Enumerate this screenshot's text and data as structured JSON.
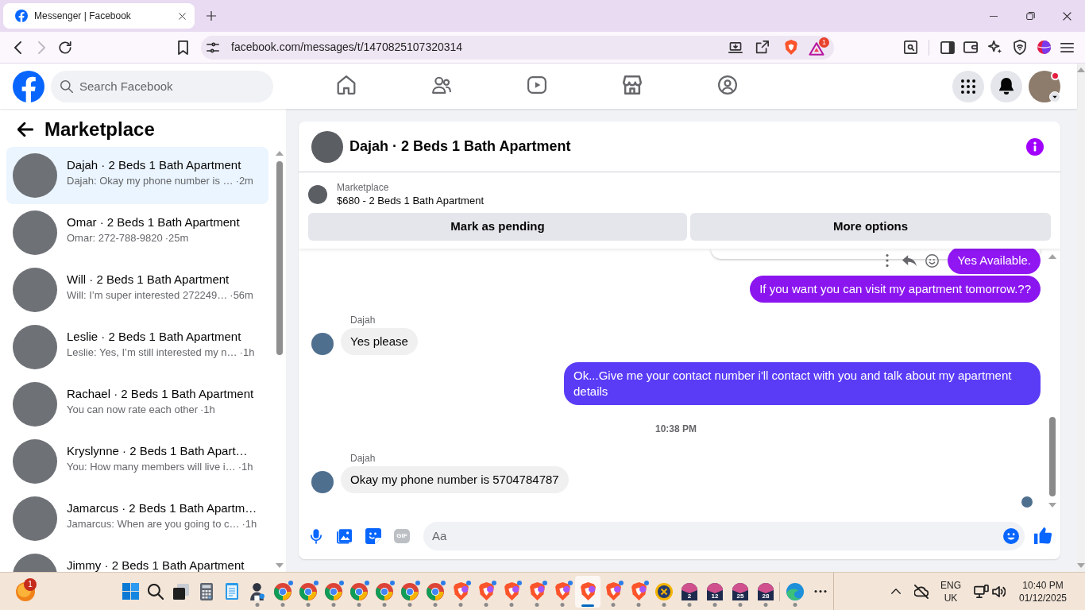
{
  "browser": {
    "tabs": [
      {
        "title": "Messenger | Facebook",
        "selected": true
      }
    ],
    "nav": [
      {
        "kind": "back",
        "disabled": false
      },
      {
        "kind": "forward",
        "disabled": true
      },
      {
        "kind": "reload",
        "disabled": false
      }
    ],
    "url": "facebook.com/messages/t/1470825107320314",
    "rewards_badge": "1"
  },
  "header": {
    "search": {
      "placeholder": "Search Facebook"
    },
    "nav": [
      {
        "kind": "home",
        "selected": false
      },
      {
        "kind": "friends",
        "selected": false
      },
      {
        "kind": "video",
        "selected": false
      },
      {
        "kind": "marketplace",
        "selected": false
      },
      {
        "kind": "groups",
        "selected": false
      }
    ],
    "profile_alert": true
  },
  "sidebar": {
    "title": "Marketplace",
    "conversations": [
      {
        "title": "Dajah · 2 Beds 1 Bath Apartment",
        "preview": "Dajah: Okay my phone number is …",
        "time": "·2m",
        "selected": true
      },
      {
        "title": "Omar · 2 Beds 1 Bath Apartment",
        "preview": "Omar: 272-788-9820",
        "time": "·25m",
        "selected": false
      },
      {
        "title": "Will · 2 Beds 1 Bath Apartment",
        "preview": "Will: I’m super interested 272249…",
        "time": "·56m",
        "selected": false
      },
      {
        "title": "Leslie · 2 Beds 1 Bath Apartment",
        "preview": "Leslie: Yes, I’m still interested my n…",
        "time": "·1h",
        "selected": false
      },
      {
        "title": "Rachael · 2 Beds 1 Bath Apartment",
        "preview": "You can now rate each other",
        "time": "·1h",
        "selected": false
      },
      {
        "title": "Kryslynne · 2 Beds 1 Bath Apart…",
        "preview": "You: How many members will live i…",
        "time": "·1h",
        "selected": false
      },
      {
        "title": "Jamarcus · 2 Beds 1 Bath Apartm…",
        "preview": "Jamarcus: When are you going to c…",
        "time": "·1h",
        "selected": false
      },
      {
        "title": "Jimmy · 2 Beds 1 Bath Apartment",
        "selected": false
      }
    ]
  },
  "chat": {
    "title": "Dajah · 2 Beds 1 Bath Apartment",
    "listing": {
      "source": "Marketplace",
      "title": "$680 - 2 Beds 1 Bath Apartment"
    },
    "actions": [
      {
        "label": "Mark as pending"
      },
      {
        "label": "More options"
      }
    ],
    "messages": [
      {
        "kind": "outgoing",
        "text": "Yes Available.",
        "color": "#9017f2",
        "hovered": true
      },
      {
        "kind": "outgoing",
        "text": "If you want you can visit my apartment tomorrow.??",
        "color": "#8b15ef",
        "hovered": false
      },
      {
        "kind": "incoming",
        "sender": "Dajah",
        "text": "Yes please"
      },
      {
        "kind": "outgoing",
        "text": "Ok...Give me your contact number i'll contact with you and talk about my apartment details",
        "color": "#5a3cf6",
        "hovered": false
      },
      {
        "kind": "timestamp",
        "text": "10:38 PM"
      },
      {
        "kind": "incoming",
        "sender": "Dajah",
        "text": "Okay my phone number is 5704784787"
      }
    ],
    "seen": true,
    "composer": {
      "tools": [
        {
          "kind": "mic",
          "disabled": false
        },
        {
          "kind": "photo",
          "disabled": false
        },
        {
          "kind": "sticker",
          "disabled": false
        },
        {
          "kind": "gif",
          "label": "GIF",
          "disabled": true
        }
      ],
      "placeholder": "Aa"
    }
  },
  "taskbar": {
    "widget": {
      "badge": "1"
    },
    "apps": [
      {
        "kind": "start",
        "running": false,
        "selected": false,
        "notified": false
      },
      {
        "kind": "search",
        "running": false,
        "selected": false,
        "notified": false
      },
      {
        "kind": "task-view",
        "running": false,
        "selected": false,
        "notified": false
      },
      {
        "kind": "calculator",
        "running": false,
        "selected": false,
        "notified": false
      },
      {
        "kind": "notepad",
        "running": false,
        "selected": false,
        "notified": false
      },
      {
        "kind": "app",
        "running": true,
        "selected": false,
        "notified": false
      },
      {
        "kind": "chrome",
        "running": true,
        "selected": false,
        "notified": true
      },
      {
        "kind": "chrome",
        "running": true,
        "selected": false,
        "notified": true
      },
      {
        "kind": "chrome",
        "running": true,
        "selected": false,
        "notified": true
      },
      {
        "kind": "chrome",
        "running": true,
        "selected": false,
        "notified": true
      },
      {
        "kind": "chrome",
        "running": true,
        "selected": false,
        "notified": true
      },
      {
        "kind": "chrome",
        "running": true,
        "selected": false,
        "notified": true
      },
      {
        "kind": "chrome",
        "running": true,
        "selected": false,
        "notified": true
      },
      {
        "kind": "brave",
        "running": true,
        "selected": false,
        "notified": true
      },
      {
        "kind": "brave",
        "running": true,
        "selected": false,
        "notified": true
      },
      {
        "kind": "brave",
        "running": true,
        "selected": false,
        "notified": true
      },
      {
        "kind": "brave",
        "running": true,
        "selected": false,
        "notified": true
      },
      {
        "kind": "brave",
        "running": true,
        "selected": false,
        "notified": true
      },
      {
        "kind": "brave",
        "running": true,
        "selected": true,
        "notified": false
      },
      {
        "kind": "brave",
        "running": true,
        "selected": false,
        "notified": true
      },
      {
        "kind": "brave",
        "running": true,
        "selected": false,
        "notified": true
      },
      {
        "kind": "ix",
        "running": true,
        "selected": false,
        "notified": false
      },
      {
        "kind": "tile",
        "label": "2",
        "running": true,
        "selected": false,
        "notified": false
      },
      {
        "kind": "tile",
        "label": "12",
        "running": true,
        "selected": false,
        "notified": false
      },
      {
        "kind": "tile",
        "label": "25",
        "running": true,
        "selected": false,
        "notified": false
      },
      {
        "kind": "tile",
        "label": "28",
        "running": true,
        "selected": false,
        "notified": false
      },
      {
        "kind": "edge",
        "running": true,
        "selected": false,
        "notified": false
      },
      {
        "kind": "more",
        "running": false,
        "selected": false,
        "notified": false
      }
    ],
    "tray": {
      "language": "ENG",
      "region": "UK",
      "time": "10:40 PM",
      "date": "01/12/2025"
    }
  }
}
